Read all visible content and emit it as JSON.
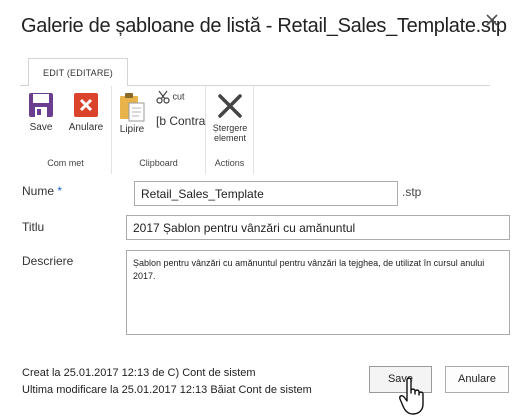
{
  "dialog": {
    "title": "Galerie de șabloane de listă - Retail_Sales_Template.stp",
    "close_icon": "close-icon"
  },
  "ribbon": {
    "tab_label": "EDIT (EDITARE)",
    "groups": {
      "commit": {
        "label": "Com met",
        "save_label": "Save",
        "cancel_label": "Anulare"
      },
      "clipboard": {
        "label": "Clipboard",
        "paste_label": "Lipire",
        "cut_label": "cut",
        "copy_label": "[b Contra"
      },
      "actions": {
        "label": "Actions",
        "delete_label_1": "Ștergere",
        "delete_label_2": "element"
      }
    },
    "colors": {
      "save_icon": "#6b3d8f",
      "cancel_icon": "#d9442b",
      "delete_icon": "#444444",
      "paste_icon": "#e8b34a"
    }
  },
  "form": {
    "name_label": "Nume",
    "required_marker": "*",
    "name_value": "Retail_Sales_Template",
    "name_suffix": ".stp",
    "title_label": "Titlu",
    "title_value": "2017 Șablon pentru vânzări cu amănuntul",
    "description_label": "Descriere",
    "description_value": "Șablon pentru vânzări cu amănuntul pentru vânzări la tejghea, de utilizat în cursul anului 2017."
  },
  "footer": {
    "created": "Creat la 25.01.2017 12:13 de C) Cont de sistem",
    "modified": "Ultima modificare la 25.01.2017 12:13 Băiat Cont de sistem",
    "save_label": "Save",
    "cancel_label": "Anulare"
  }
}
